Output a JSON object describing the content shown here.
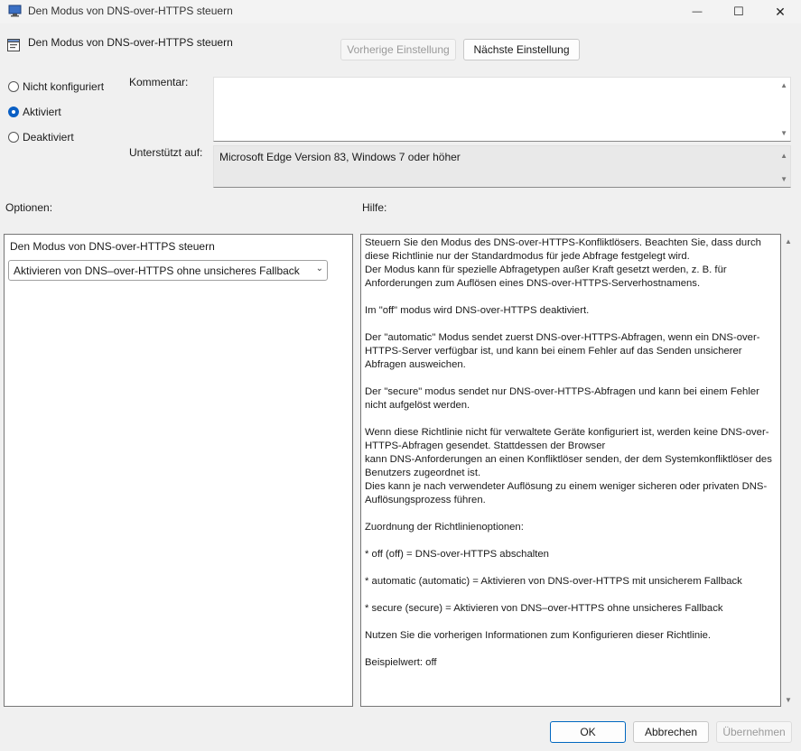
{
  "window": {
    "title": "Den Modus von DNS-over-HTTPS steuern",
    "minimize_glyph": "—",
    "maximize_glyph": "☐",
    "close_glyph": "✕"
  },
  "header": {
    "policy_name": "Den Modus von DNS-over-HTTPS steuern",
    "prev_label": "Vorherige Einstellung",
    "next_label": "Nächste Einstellung"
  },
  "state": {
    "options": [
      {
        "label": "Nicht konfiguriert",
        "checked": false
      },
      {
        "label": "Aktiviert",
        "checked": true
      },
      {
        "label": "Deaktiviert",
        "checked": false
      }
    ]
  },
  "comment": {
    "label": "Kommentar:",
    "value": ""
  },
  "supported": {
    "label": "Unterstützt auf:",
    "value": "Microsoft Edge Version 83, Windows 7 oder höher"
  },
  "options_section": {
    "heading": "Optionen:",
    "field_label": "Den Modus von DNS-over-HTTPS steuern",
    "selected_value": "Aktivieren von DNS–over-HTTPS ohne unsicheres Fallback"
  },
  "help_section": {
    "heading": "Hilfe:",
    "paragraphs": [
      "Steuern Sie den Modus des DNS-over-HTTPS-Konfliktlösers. Beachten Sie, dass durch diese Richtlinie nur der Standardmodus für jede Abfrage festgelegt wird.\nDer Modus kann für spezielle Abfragetypen außer Kraft gesetzt werden, z. B. für Anforderungen zum Auflösen eines DNS-over-HTTPS-Serverhostnamens.",
      "Im \"off\" modus wird DNS-over-HTTPS deaktiviert.",
      "Der \"automatic\" Modus sendet zuerst DNS-over-HTTPS-Abfragen, wenn ein DNS-over-HTTPS-Server verfügbar ist, und kann bei einem Fehler auf das Senden unsicherer Abfragen ausweichen.",
      "Der \"secure\" modus sendet nur DNS-over-HTTPS-Abfragen und kann bei einem Fehler nicht aufgelöst werden.",
      "Wenn diese Richtlinie nicht für verwaltete Geräte konfiguriert ist, werden keine DNS-over-HTTPS-Abfragen gesendet. Stattdessen der Browser\nkann DNS-Anforderungen an einen Konfliktlöser senden, der dem Systemkonfliktlöser des Benutzers zugeordnet ist.\nDies kann je nach verwendeter Auflösung zu einem weniger sicheren oder privaten DNS-Auflösungsprozess führen.",
      "Zuordnung der Richtlinienoptionen:",
      "* off (off) = DNS-over-HTTPS abschalten",
      "* automatic (automatic) = Aktivieren von DNS-over-HTTPS mit unsicherem Fallback",
      "* secure (secure) = Aktivieren von DNS–over-HTTPS ohne unsicheres Fallback",
      "Nutzen Sie die vorherigen Informationen zum Konfigurieren dieser Richtlinie.",
      "Beispielwert: off"
    ]
  },
  "footer": {
    "ok_label": "OK",
    "cancel_label": "Abbrechen",
    "apply_label": "Übernehmen"
  }
}
